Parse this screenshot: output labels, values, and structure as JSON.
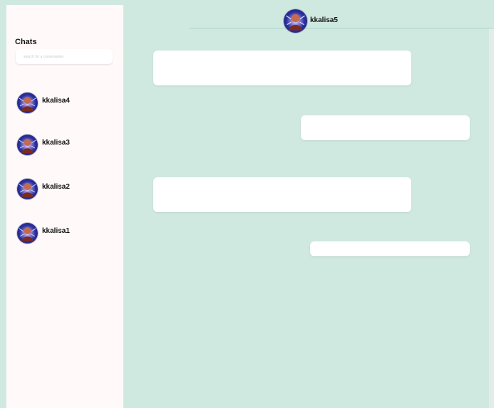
{
  "sidebar": {
    "title": "Chats",
    "search_placeholder": "search for a conversation",
    "contacts": [
      {
        "name": "kkalisa4",
        "avatar_icon": "user-avatar-icon"
      },
      {
        "name": "kkalisa3",
        "avatar_icon": "user-avatar-icon"
      },
      {
        "name": "kkalisa2",
        "avatar_icon": "user-avatar-icon"
      },
      {
        "name": "kkalisa1",
        "avatar_icon": "user-avatar-icon"
      }
    ]
  },
  "chat": {
    "recipient_name": "kkalisa5",
    "messages": [
      {
        "side": "received",
        "text": ""
      },
      {
        "side": "sent",
        "text": ""
      },
      {
        "side": "received",
        "text": ""
      },
      {
        "side": "sent",
        "text": ""
      }
    ]
  },
  "colors": {
    "chat_background": "#cfe9e1",
    "sidebar_background": "#fffaf9",
    "bubble_background": "#ffffff",
    "header_divider": "#a9d4c6"
  }
}
